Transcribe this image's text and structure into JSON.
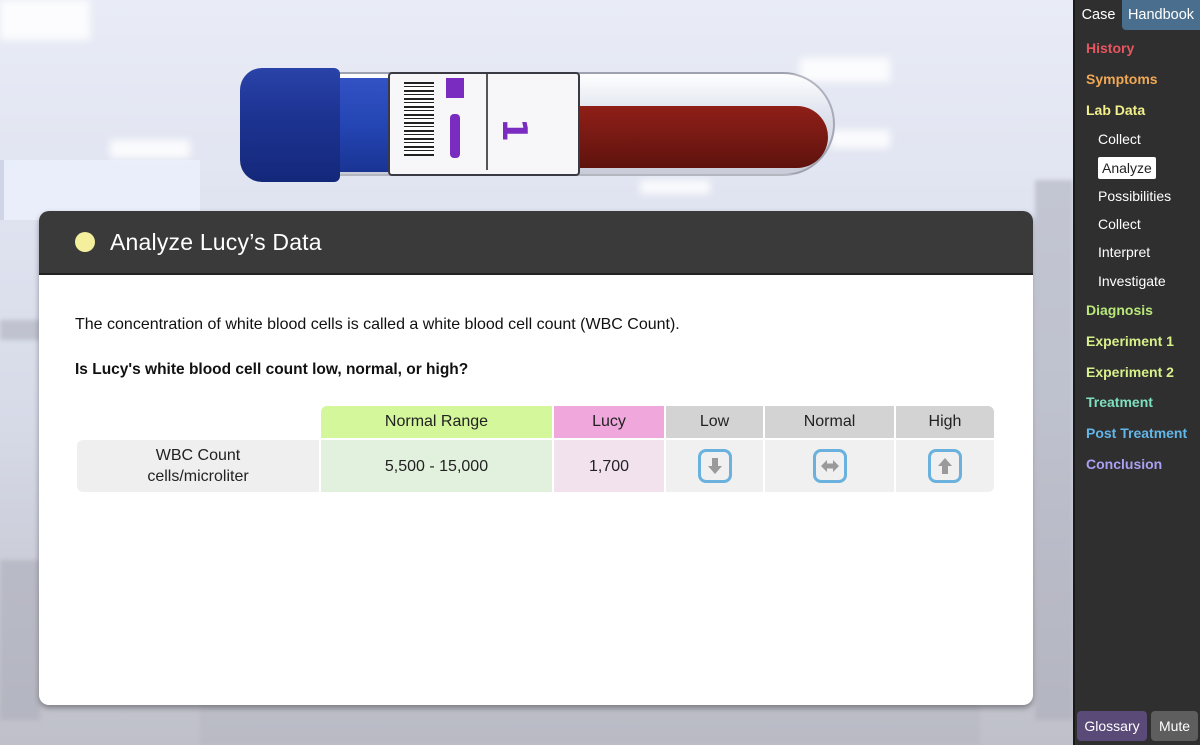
{
  "sidebar": {
    "tabs": [
      {
        "label": "Case",
        "active": true
      },
      {
        "label": "Handbook",
        "active": false
      }
    ],
    "nav": [
      {
        "label": "History",
        "color": "#e8555f",
        "level": 1
      },
      {
        "label": "Symptoms",
        "color": "#f0a855",
        "level": 1
      },
      {
        "label": "Lab Data",
        "color": "#f2f08a",
        "level": 1
      },
      {
        "label": "Collect",
        "color": "#ffffff",
        "level": 2
      },
      {
        "label": "Analyze",
        "color": "#222222",
        "level": 2,
        "active": true
      },
      {
        "label": "Possibilities",
        "color": "#ffffff",
        "level": 2
      },
      {
        "label": "Collect",
        "color": "#ffffff",
        "level": 2
      },
      {
        "label": "Interpret",
        "color": "#ffffff",
        "level": 2
      },
      {
        "label": "Investigate",
        "color": "#ffffff",
        "level": 2
      },
      {
        "label": "Diagnosis",
        "color": "#b8e87a",
        "level": 1
      },
      {
        "label": "Experiment 1",
        "color": "#d8f08a",
        "level": 1
      },
      {
        "label": "Experiment 2",
        "color": "#d8f08a",
        "level": 1
      },
      {
        "label": "Treatment",
        "color": "#7fe0c0",
        "level": 1
      },
      {
        "label": "Post Treatment",
        "color": "#62b6e8",
        "level": 1
      },
      {
        "label": "Conclusion",
        "color": "#a8a0f0",
        "level": 1
      }
    ],
    "glossary_label": "Glossary",
    "mute_label": "Mute"
  },
  "tube": {
    "label_number": "1"
  },
  "panel": {
    "title": "Analyze Lucy’s Data",
    "status_dot_color": "#f4ef9c",
    "intro": "The concentration of white blood cells is called a white blood cell count (WBC Count).",
    "question": "Is Lucy's white blood cell count low, normal, or high?"
  },
  "table": {
    "headers": {
      "label": "",
      "normal_range": "Normal Range",
      "lucy": "Lucy",
      "low": "Low",
      "normal": "Normal",
      "high": "High"
    },
    "row": {
      "label_line1": "WBC Count",
      "label_line2": "cells/microliter",
      "normal_range": "5,500 - 15,000",
      "lucy": "1,700",
      "choices": [
        {
          "name": "low",
          "icon": "arrow-down-icon"
        },
        {
          "name": "normal",
          "icon": "arrow-left-right-icon"
        },
        {
          "name": "high",
          "icon": "arrow-up-icon"
        }
      ]
    },
    "colors": {
      "normal_range_header": "#d3f79a",
      "lucy_header": "#f0a8dc",
      "choice_border": "#6ab1de"
    }
  }
}
